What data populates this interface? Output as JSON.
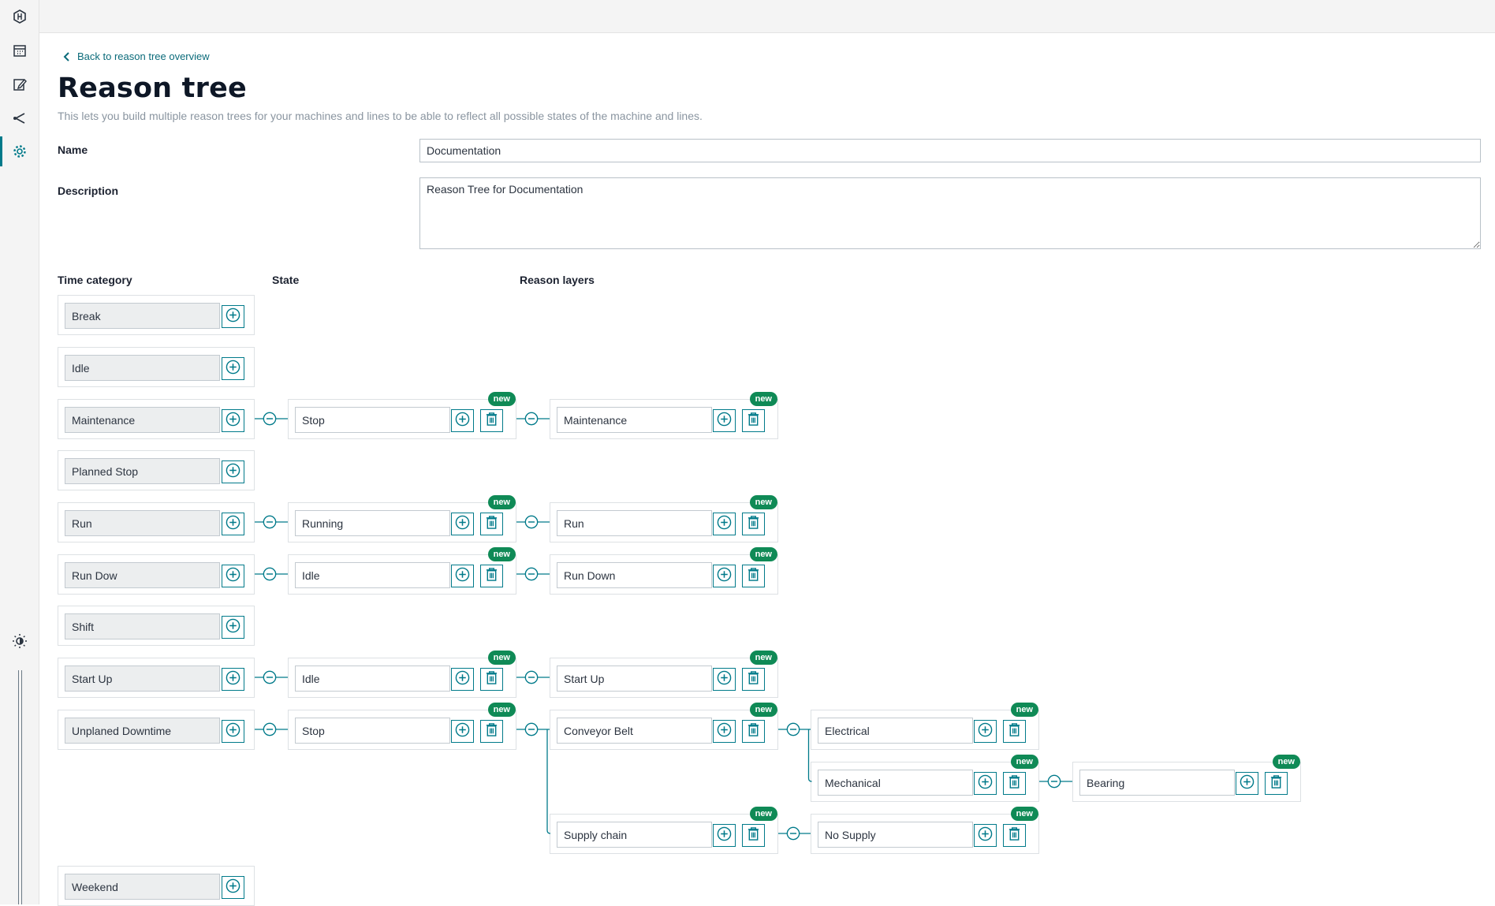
{
  "nav": {
    "back_label": "Back to reason tree overview",
    "icons": [
      "app-logo-icon",
      "calendar-icon",
      "edit-icon",
      "share-icon",
      "gear-icon",
      "theme-icon"
    ]
  },
  "page": {
    "title": "Reason tree",
    "subtitle": "This lets you build multiple reason trees for your machines and lines to be able to reflect all possible states of the machine and lines."
  },
  "form": {
    "name_label": "Name",
    "name_value": "Documentation",
    "description_label": "Description",
    "description_value": "Reason Tree for Documentation"
  },
  "columns": {
    "time_category": "Time category",
    "state": "State",
    "reason_layers": "Reason layers"
  },
  "badge_label": "new",
  "time_categories": [
    "Break",
    "Idle",
    "Maintenance",
    "Planned Stop",
    "Run",
    "Run Dow",
    "Shift",
    "Start Up",
    "Unplaned Downtime",
    "Weekend"
  ],
  "states": [
    "Stop",
    "Running",
    "Idle",
    "Idle",
    "Stop"
  ],
  "reasons": {
    "layer1": [
      "Maintenance",
      "Run",
      "Run Down",
      "Start Up",
      "Conveyor Belt",
      "Supply chain"
    ],
    "layer2": [
      "Electrical",
      "Mechanical",
      "No Supply"
    ],
    "layer3": [
      "Bearing"
    ]
  },
  "colors": {
    "accent": "#007a8a",
    "badge": "#0f8a56",
    "title": "#0e1726"
  }
}
